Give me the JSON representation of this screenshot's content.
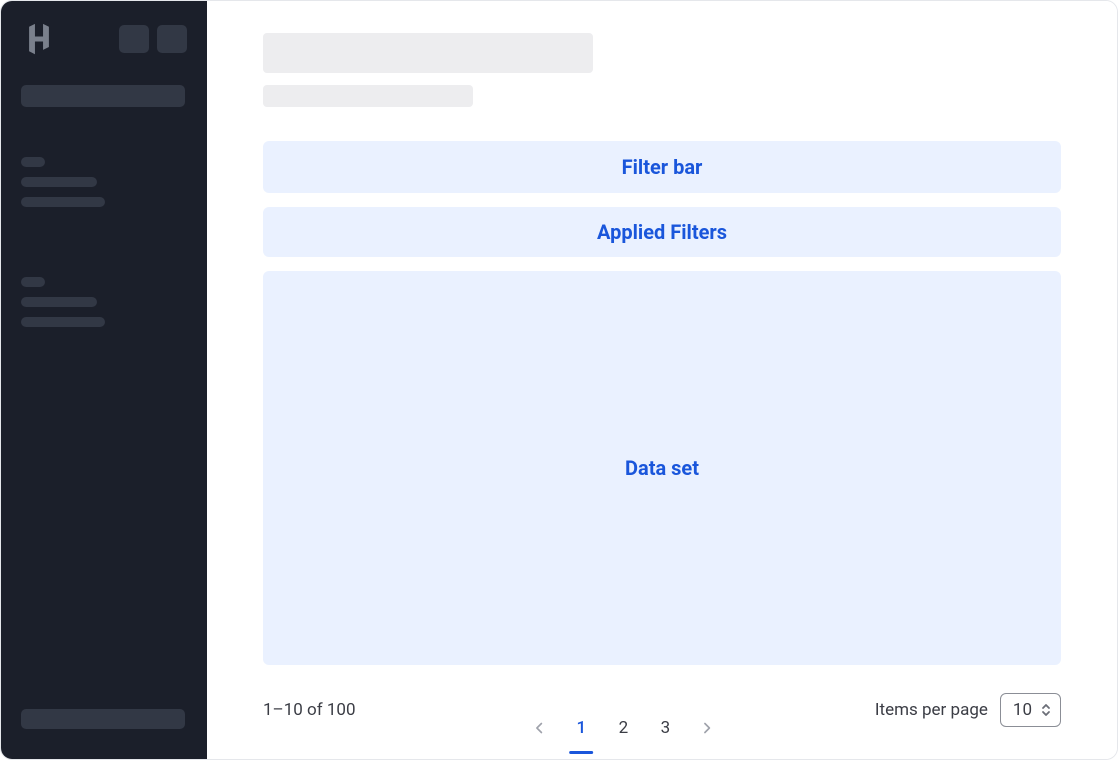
{
  "placeholders": {
    "filter_bar": "Filter bar",
    "applied_filters": "Applied Filters",
    "data_set": "Data set"
  },
  "pagination": {
    "range_text": "1–10 of 100",
    "pages": [
      "1",
      "2",
      "3"
    ],
    "active_page": "1",
    "items_per_page_label": "Items per page",
    "items_per_page_value": "10"
  }
}
